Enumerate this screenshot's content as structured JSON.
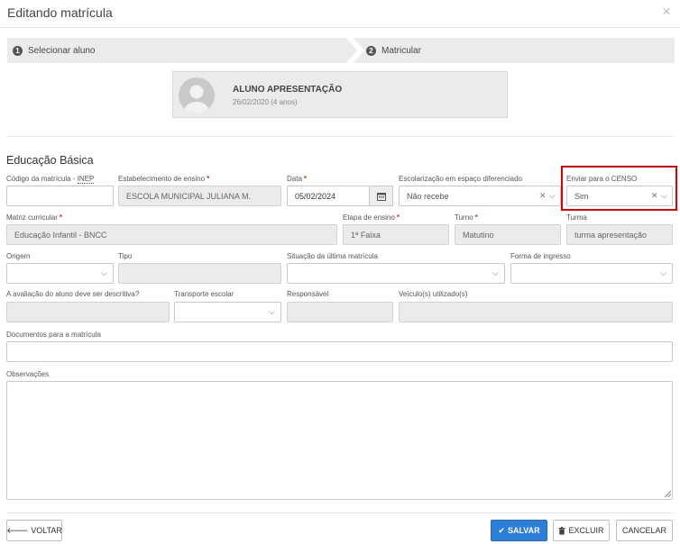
{
  "modal": {
    "title": "Editando matrícula",
    "close": "×"
  },
  "steps": [
    {
      "number": "1",
      "label": "Selecionar aluno"
    },
    {
      "number": "2",
      "label": "Matricular"
    }
  ],
  "student": {
    "name": "ALUNO APRESENTAÇÃO",
    "date": "26/02/2020 (4 anos)"
  },
  "section_title": "Educação Básica",
  "fields": {
    "codigo": {
      "label_pre": "Código da matrícula - ",
      "label_abbr": "INEP",
      "value": ""
    },
    "estabelecimento": {
      "label": "Estabelecimento de ensino",
      "required": "*",
      "value": "ESCOLA MUNICIPAL JULIANA M."
    },
    "data": {
      "label": "Data",
      "required": "*",
      "value": "05/02/2024"
    },
    "escolarizacao": {
      "label": "Escolarização em espaço diferenciado",
      "value": "Não recebe"
    },
    "censo": {
      "label": "Enviar para o CENSO",
      "value": "Sim"
    },
    "matriz": {
      "label": "Matriz curricular",
      "required": "*",
      "value": "Educação Infantil - BNCC"
    },
    "etapa": {
      "label": "Etapa de ensino",
      "required": "*",
      "value": "1ª Faixa"
    },
    "turno": {
      "label": "Turno",
      "required": "*",
      "value": "Matutino"
    },
    "turma": {
      "label": "Turma",
      "value": "turma apresentação"
    },
    "origem": {
      "label": "Origem",
      "value": ""
    },
    "tipo": {
      "label": "Tipo",
      "value": ""
    },
    "situacao": {
      "label": "Situação da última matrícula",
      "value": ""
    },
    "forma": {
      "label": "Forma de ingresso",
      "value": ""
    },
    "avaliacao": {
      "label": "A avaliação do aluno deve ser descritiva?",
      "value": ""
    },
    "transporte": {
      "label": "Transporte escolar",
      "value": ""
    },
    "responsavel": {
      "label": "Responsável",
      "value": ""
    },
    "veiculos": {
      "label": "Veículo(s) utilizado(s)",
      "value": ""
    },
    "documentos": {
      "label": "Documentos para a matrícula",
      "value": ""
    },
    "observacoes": {
      "label": "Observações",
      "value": ""
    }
  },
  "buttons": {
    "voltar": "VOLTAR",
    "salvar": "SALVAR",
    "excluir": "EXCLUIR",
    "cancelar": "CANCELAR"
  },
  "colors": {
    "primary": "#2b7fd8",
    "highlight": "#e00000",
    "required": "#d32f2f"
  },
  "icons": [
    "close-icon",
    "avatar-icon",
    "calendar-icon",
    "clear-icon",
    "chevron-down-icon",
    "arrow-left-icon",
    "check-icon",
    "trash-icon",
    "resize-icon"
  ]
}
